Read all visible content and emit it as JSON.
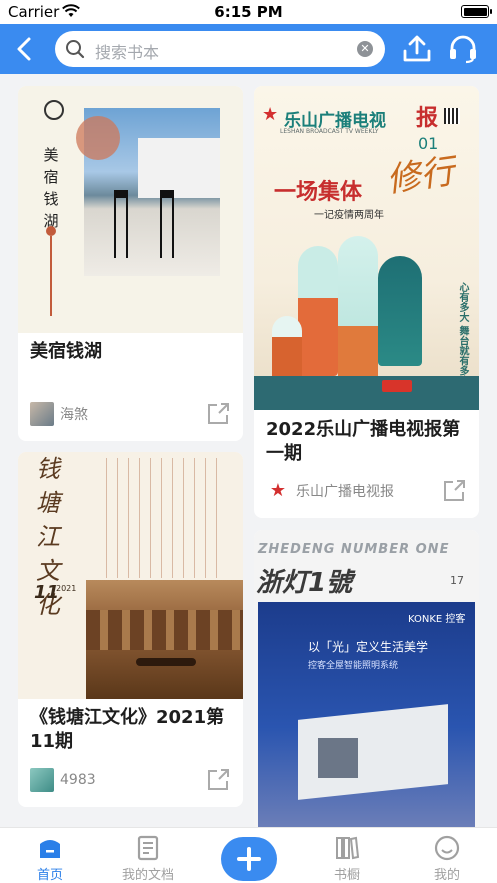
{
  "status_bar": {
    "carrier": "Carrier",
    "time": "6:15 PM"
  },
  "search": {
    "placeholder": "搜索书本"
  },
  "feed": [
    {
      "title": "美宿钱湖",
      "author": "海煞",
      "cover_text": [
        "美",
        "宿",
        "钱",
        "湖"
      ]
    },
    {
      "title": "2022乐山广播电视报第一期",
      "author": "乐山广播电视报",
      "cover": {
        "masthead": "乐山广播电视",
        "masthead_tag": "报",
        "subtitle": "LESHAN BROADCAST TV WEEKLY",
        "issue": "01",
        "headline": "一场集体",
        "headline_script": "修行",
        "sub": "一记疫情两周年",
        "side": "心有多大 舞台就有多大"
      }
    },
    {
      "title": "《钱塘江文化》2021第11期",
      "author": "4983",
      "cover_text": [
        "钱",
        "塘",
        "江",
        "文",
        "化"
      ],
      "cover_issue": "11",
      "cover_year": "2021"
    },
    {
      "title": "",
      "author": "",
      "cover": {
        "masthead": "ZHEDENG NUMBER ONE",
        "masthead_cn": "浙灯1號",
        "issue_no": "17",
        "brand": "KONKE 控客",
        "tagline": "以「光」定义生活美学",
        "tagline2": "控客全屋智能照明系统"
      }
    }
  ],
  "bottom_nav": [
    {
      "label": "首页",
      "icon": "home-icon",
      "active": true
    },
    {
      "label": "我的文档",
      "icon": "document-icon",
      "active": false
    },
    {
      "label": "书橱",
      "icon": "bookshelf-icon",
      "active": false
    },
    {
      "label": "我的",
      "icon": "profile-icon",
      "active": false
    }
  ],
  "colors": {
    "primary": "#3a8bf0",
    "active_tab": "#2b7fe8"
  }
}
